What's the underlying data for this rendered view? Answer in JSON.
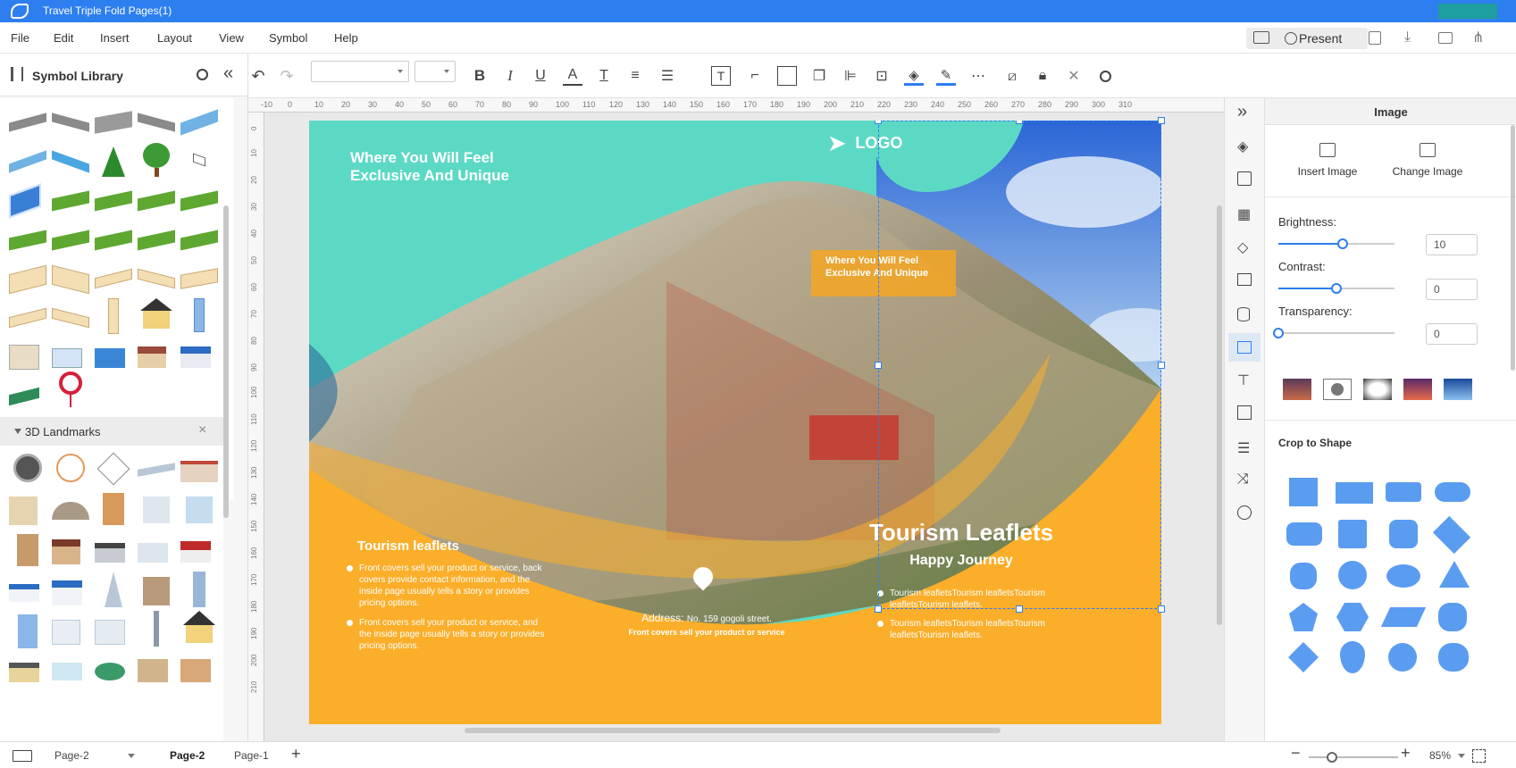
{
  "app": {
    "title": "Travel Triple Fold Pages(1)"
  },
  "menu": [
    "File",
    "Edit",
    "Insert",
    "Layout",
    "View",
    "Symbol",
    "Help"
  ],
  "toolbar": {
    "present_label": "Present"
  },
  "library": {
    "title": "Symbol Library",
    "section2": "3D Landmarks"
  },
  "ruler": {
    "h": [
      "-10",
      "0",
      "10",
      "20",
      "30",
      "40",
      "50",
      "60",
      "70",
      "80",
      "90",
      "100",
      "110",
      "120",
      "130",
      "140",
      "150",
      "160",
      "170",
      "180",
      "190",
      "200",
      "210",
      "220",
      "230",
      "240",
      "250",
      "260",
      "270",
      "280",
      "290",
      "300",
      "310"
    ],
    "v": [
      "0",
      "10",
      "20",
      "30",
      "40",
      "50",
      "60",
      "70",
      "80",
      "90",
      "100",
      "110",
      "120",
      "130",
      "140",
      "150",
      "160",
      "170",
      "180",
      "190",
      "200",
      "210"
    ]
  },
  "canvas": {
    "headline": "Where You Will Feel Exclusive And Unique",
    "logo": "LOGO",
    "overlay_text": "Where You Will Feel Exclusive And Unique",
    "left_heading": "Tourism leaflets",
    "left_bullets": [
      "Front covers sell your product or service, back covers provide contact information, and the inside page usually tells a story or provides pricing options.",
      "Front covers sell your product or service, and the inside page usually tells a story or provides pricing options."
    ],
    "address_label": "Address:",
    "address_value": "No. 159 gogoli street.",
    "address_sub": "Front covers sell your product or service",
    "right_title": "Tourism Leaflets",
    "right_subtitle": "Happy Journey",
    "right_bullets": [
      "Tourism leafletsTourism leafletsTourism leafletsTourism leaflets.",
      "Tourism leafletsTourism leafletsTourism leafletsTourism leaflets."
    ]
  },
  "panel": {
    "title": "Image",
    "insert_image": "Insert Image",
    "change_image": "Change Image",
    "brightness_label": "Brightness:",
    "brightness_value": "10",
    "brightness_level": 0.55,
    "contrast_label": "Contrast:",
    "contrast_value": "0",
    "contrast_level": 0.5,
    "transparency_label": "Transparency:",
    "transparency_value": "0",
    "transparency_level": 0,
    "crop_title": "Crop to Shape"
  },
  "status": {
    "page_select": "Page-2",
    "tabs": [
      "Page-2",
      "Page-1"
    ],
    "zoom": "85%"
  },
  "colors": {
    "accent": "#2d7ff0",
    "teal": "#5cd9c4",
    "orange": "#fbae29",
    "shape": "#5a9cf0"
  }
}
